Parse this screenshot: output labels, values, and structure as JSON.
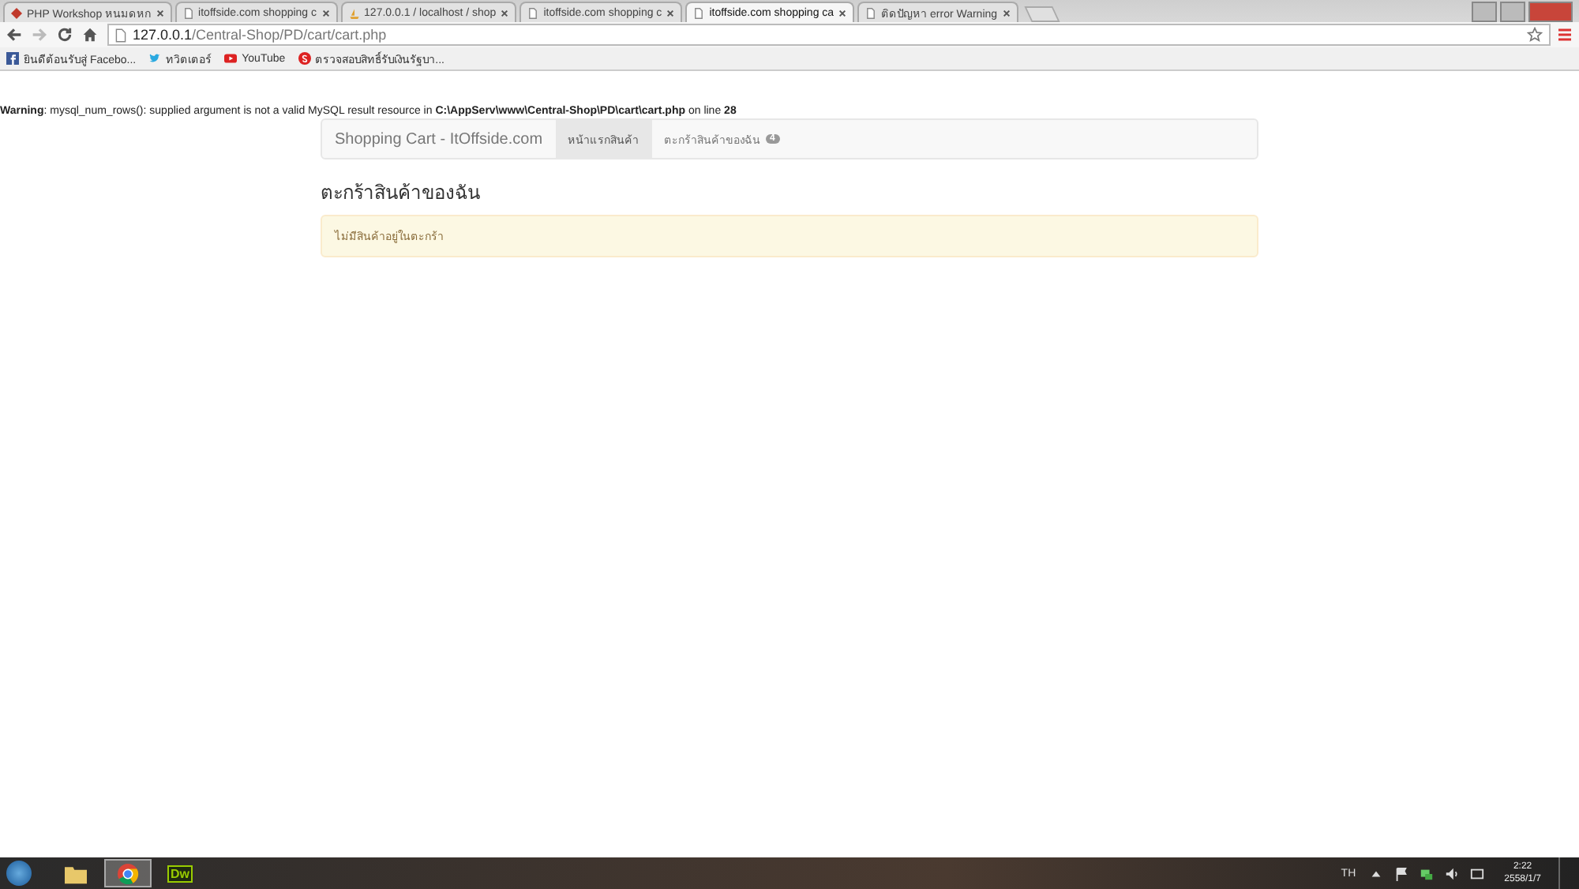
{
  "browser": {
    "tabs": [
      {
        "title": "PHP Workshop หนมดหก",
        "selected": false
      },
      {
        "title": "itoffside.com shopping c",
        "selected": false
      },
      {
        "title": "127.0.0.1 / localhost / shop",
        "selected": false
      },
      {
        "title": "itoffside.com shopping c",
        "selected": false
      },
      {
        "title": "itoffside.com shopping ca",
        "selected": true
      },
      {
        "title": "ติดปัญหา error Warning",
        "selected": false
      }
    ],
    "url": {
      "host": "127.0.0.1",
      "path": "/Central-Shop/PD/cart/cart.php"
    },
    "bookmarks": [
      {
        "label": "ยินดีต้อนรับสู่ Facebo..."
      },
      {
        "label": "ทวิตเตอร์"
      },
      {
        "label": "YouTube"
      },
      {
        "label": "ตรวจสอบสิทธิ์รับเงินรัฐบา..."
      }
    ]
  },
  "warning": "**Warning**: mysql_num_rows(): supplied argument is not a valid MySQL result resource in **C:\\AppServ\\www\\Central-Shop\\PD\\cart\\cart.php** on line **28**",
  "navbar": {
    "brand": "Shopping Cart - ItOffside.com",
    "items": [
      {
        "label": "หน้าแรกสินค้า",
        "selected": true
      },
      {
        "label": "ตะกร้าสินค้าของฉัน",
        "selected": false,
        "badge": "4"
      }
    ]
  },
  "heading": "ตะกร้าสินค้าของฉัน",
  "alert": "ไม่มีสินค้าอยู่ในตะกร้า",
  "taskbar": {
    "apps": [
      {
        "kind": "explorer",
        "selected": false
      },
      {
        "kind": "chrome",
        "selected": true
      },
      {
        "kind": "dreamweaver",
        "selected": false,
        "label": "Dw"
      }
    ],
    "language": "TH",
    "time": "2:22",
    "date": "2558/1/7"
  }
}
